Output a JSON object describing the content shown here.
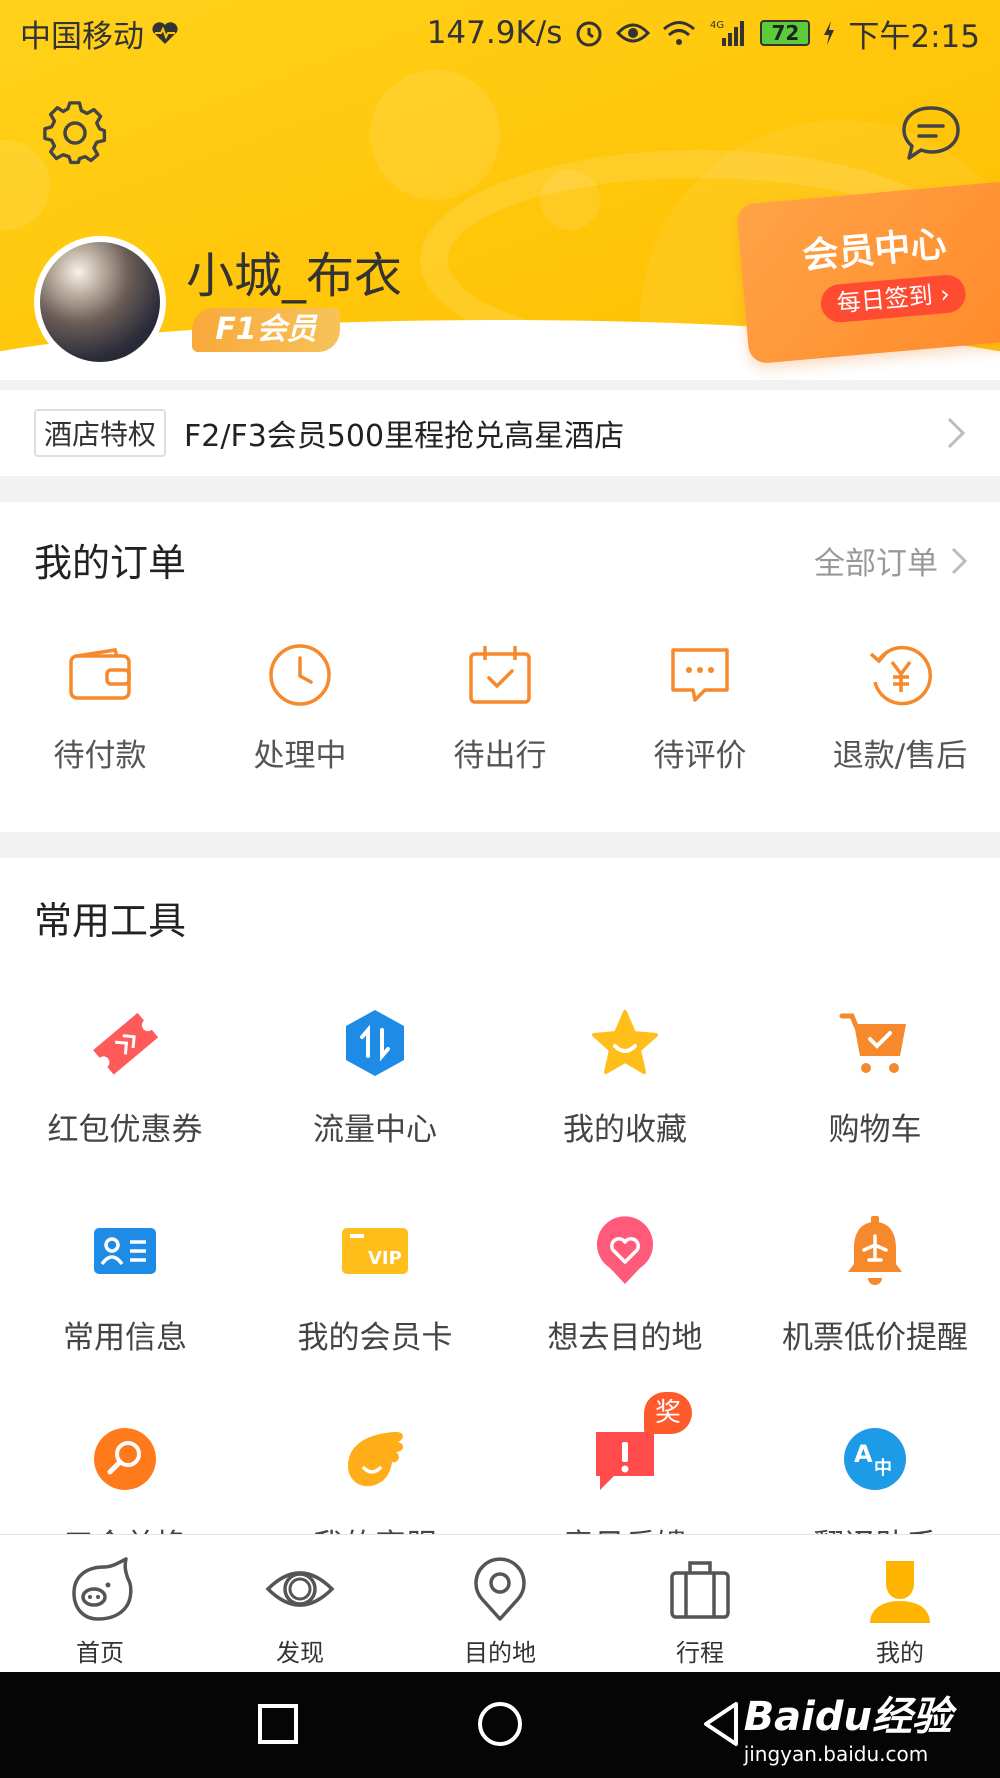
{
  "status_bar": {
    "carrier": "中国移动",
    "speed": "147.9K/s",
    "battery": "72",
    "time": "下午2:15"
  },
  "profile": {
    "username": "小城_布衣",
    "member_level": "F1会员",
    "vip_card_title": "会员中心",
    "vip_card_action": "每日签到"
  },
  "privilege": {
    "tag": "酒店特权",
    "text": "F2/F3会员500里程抢兑高星酒店"
  },
  "orders": {
    "title": "我的订单",
    "all_link": "全部订单",
    "items": [
      {
        "label": "待付款",
        "icon": "wallet-icon"
      },
      {
        "label": "处理中",
        "icon": "clock-icon"
      },
      {
        "label": "待出行",
        "icon": "calendar-check-icon"
      },
      {
        "label": "待评价",
        "icon": "comment-icon"
      },
      {
        "label": "退款/售后",
        "icon": "refund-yen-icon"
      }
    ]
  },
  "tools": {
    "title": "常用工具",
    "items": [
      {
        "label": "红包优惠券",
        "icon": "coupon-icon"
      },
      {
        "label": "流量中心",
        "icon": "data-traffic-icon"
      },
      {
        "label": "我的收藏",
        "icon": "star-icon"
      },
      {
        "label": "购物车",
        "icon": "cart-icon"
      },
      {
        "label": "常用信息",
        "icon": "contact-card-icon"
      },
      {
        "label": "我的会员卡",
        "icon": "vip-card-icon"
      },
      {
        "label": "想去目的地",
        "icon": "heart-pin-icon"
      },
      {
        "label": "机票低价提醒",
        "icon": "flight-bell-icon"
      },
      {
        "label": "口令兑换",
        "icon": "search-key-icon"
      },
      {
        "label": "我的客服",
        "icon": "service-icon"
      },
      {
        "label": "意见反馈",
        "icon": "feedback-icon",
        "badge": "奖"
      },
      {
        "label": "翻译助手",
        "icon": "translate-icon"
      }
    ]
  },
  "tabbar": {
    "items": [
      {
        "label": "首页",
        "icon": "pig-home-icon"
      },
      {
        "label": "发现",
        "icon": "discover-eye-icon"
      },
      {
        "label": "目的地",
        "icon": "location-pin-icon"
      },
      {
        "label": "行程",
        "icon": "suitcase-icon"
      },
      {
        "label": "我的",
        "icon": "profile-icon",
        "active": true
      }
    ]
  },
  "watermark": {
    "brand": "Baidu经验",
    "url": "jingyan.baidu.com"
  },
  "colors": {
    "header_yellow": "#ffc60a",
    "accent_orange": "#ff8a2a",
    "icon_orange": "#f5892b"
  }
}
